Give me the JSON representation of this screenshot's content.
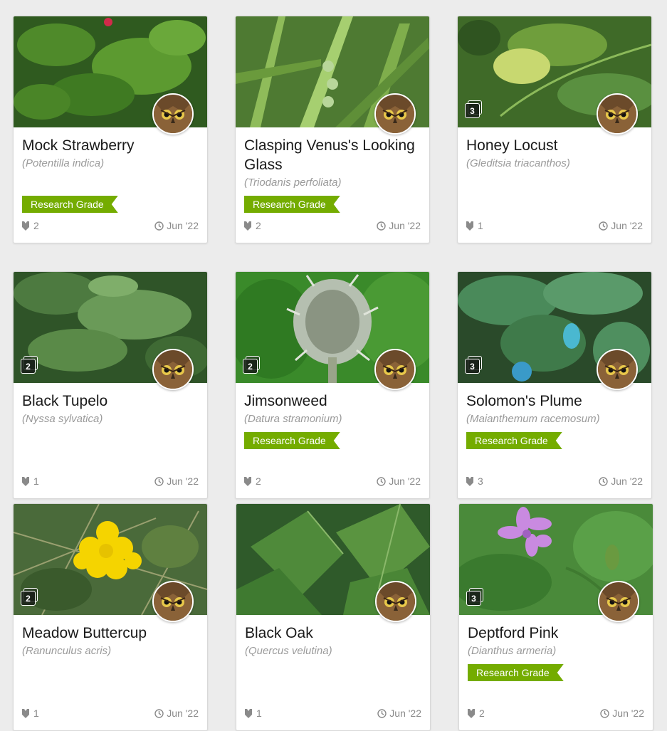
{
  "observations": [
    {
      "common": "Mock Strawberry",
      "scientific_prefix": "(",
      "scientific": "Potentilla indica",
      "scientific_suffix": ")",
      "research_grade": true,
      "photos": null,
      "ids": "2",
      "date": "Jun '22"
    },
    {
      "common": "Clasping Venus's Looking Glass",
      "scientific_prefix": "(",
      "scientific": "Triodanis perfoliata",
      "scientific_suffix": ")",
      "research_grade": true,
      "photos": null,
      "ids": "2",
      "date": "Jun '22"
    },
    {
      "common": "Honey Locust",
      "scientific_prefix": "(",
      "scientific": "Gleditsia triacanthos",
      "scientific_suffix": ")",
      "research_grade": false,
      "photos": "3",
      "ids": "1",
      "date": "Jun '22"
    },
    {
      "common": "Black Tupelo",
      "scientific_prefix": "(",
      "scientific": "Nyssa sylvatica",
      "scientific_suffix": ")",
      "research_grade": false,
      "photos": "2",
      "ids": "1",
      "date": "Jun '22"
    },
    {
      "common": "Jimsonweed",
      "scientific_prefix": "(",
      "scientific": "Datura stramonium",
      "scientific_suffix": ")",
      "research_grade": true,
      "photos": "2",
      "ids": "2",
      "date": "Jun '22"
    },
    {
      "common": "Solomon's Plume",
      "scientific_prefix": "(",
      "scientific": "Maianthemum racemosum",
      "scientific_suffix": ")",
      "research_grade": true,
      "photos": "3",
      "ids": "3",
      "date": "Jun '22"
    },
    {
      "common": "Meadow Buttercup",
      "scientific_prefix": "(",
      "scientific": "Ranunculus acris",
      "scientific_suffix": ")",
      "research_grade": false,
      "photos": "2",
      "ids": "1",
      "date": "Jun '22"
    },
    {
      "common": "Black Oak",
      "scientific_prefix": "(",
      "scientific": "Quercus velutina",
      "scientific_suffix": ")",
      "research_grade": false,
      "photos": null,
      "ids": "1",
      "date": "Jun '22"
    },
    {
      "common": "Deptford Pink",
      "scientific_prefix": "(",
      "scientific": "Dianthus armeria",
      "scientific_suffix": ")",
      "research_grade": true,
      "photos": "3",
      "ids": "2",
      "date": "Jun '22"
    }
  ],
  "research_grade_label": "Research Grade",
  "icons": {
    "identifications": "shield-icon",
    "date": "clock-icon",
    "photos": "photo-stack-icon",
    "avatar": "owl-avatar"
  },
  "colors": {
    "research_grade": "#74ac00",
    "background": "#ececec"
  }
}
